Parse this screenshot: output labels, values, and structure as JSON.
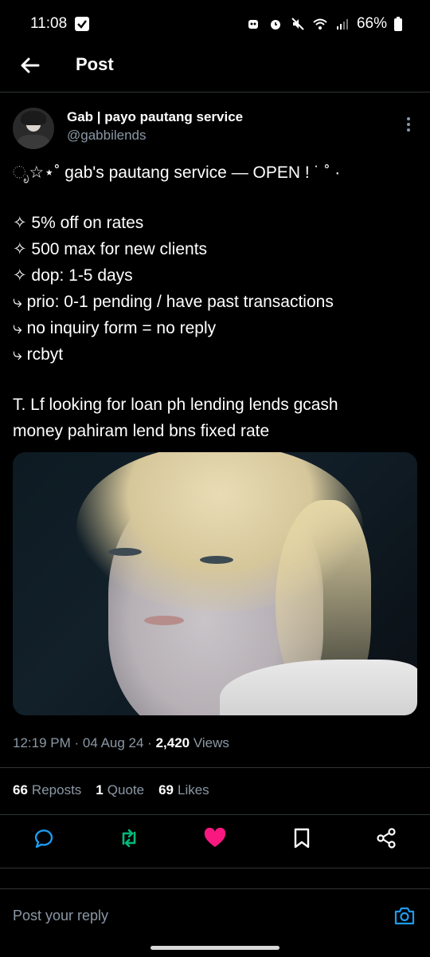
{
  "status_bar": {
    "time": "11:08",
    "battery": "66%"
  },
  "app_bar": {
    "title": "Post"
  },
  "post": {
    "author_name": "Gab | payo pautang service",
    "author_handle": "@gabbilends",
    "text_lines": [
      "ೃ☆⋆˚ gab's pautang service — OPEN ! ˙ ˚ ·",
      "",
      "✧ 5% off on rates",
      "✧ 500 max for new clients",
      "✧ dop: 1-5 days",
      "⤷ prio: 0-1 pending / have past transactions",
      "⤷ no inquiry form = no reply",
      "⤷ rcbyt",
      "",
      "T. Lf looking for loan ph lending lends gcash",
      "money pahiram lend bns fixed rate"
    ],
    "time": "12:19 PM",
    "date": "04 Aug 24",
    "views_count": "2,420",
    "views_label": "Views",
    "reposts_count": "66",
    "reposts_label": "Reposts",
    "quotes_count": "1",
    "quotes_label": "Quote",
    "likes_count": "69",
    "likes_label": "Likes"
  },
  "actions": {
    "reply_icon": "comment-icon",
    "repost_icon": "repost-icon",
    "like_icon": "heart-icon",
    "bookmark_icon": "bookmark-icon",
    "share_icon": "share-icon",
    "repost_color": "#00ba7c",
    "like_color": "#f91880"
  },
  "reply": {
    "placeholder": "Post your reply"
  },
  "colors": {
    "background": "#000000",
    "accent": "#1d9bf0",
    "muted": "#8b98a5",
    "divider": "#2f3336"
  }
}
